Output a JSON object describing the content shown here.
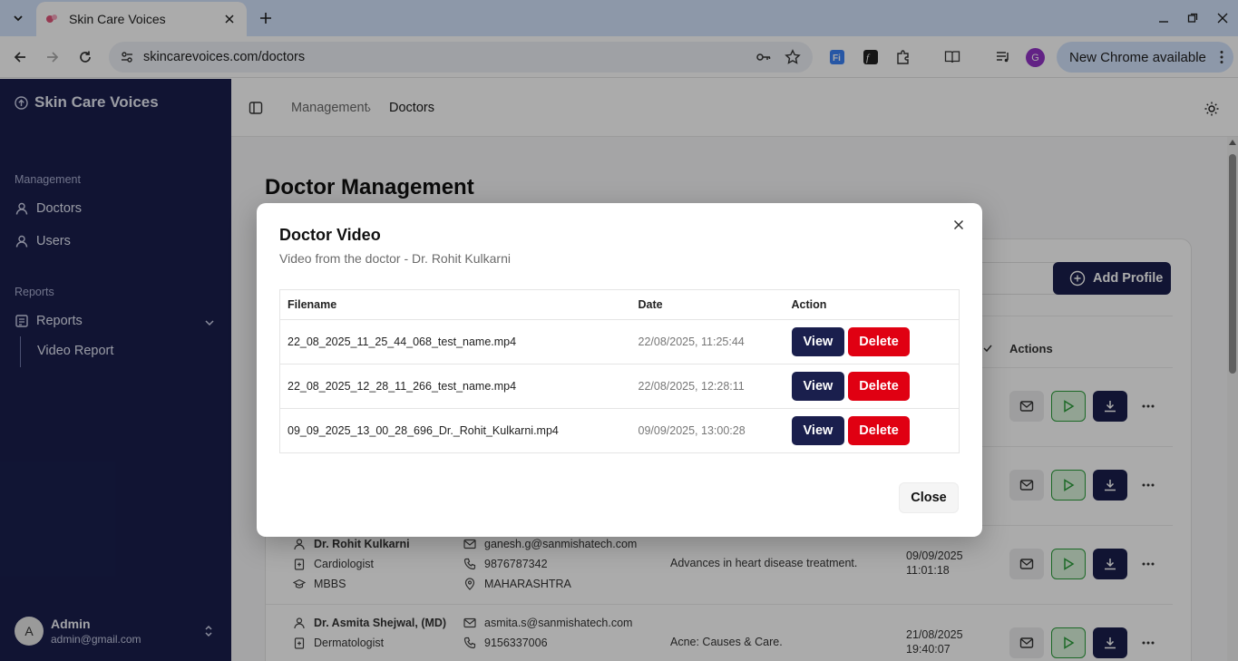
{
  "browser": {
    "tab_title": "Skin Care Voices",
    "url": "skincarevoices.com/doctors",
    "profile_initial": "G",
    "update_label": "New Chrome available"
  },
  "sidebar": {
    "brand": "Skin Care Voices",
    "section_management": "Management",
    "items": [
      {
        "label": "Doctors",
        "icon": "user-icon"
      },
      {
        "label": "Users",
        "icon": "user-icon"
      }
    ],
    "section_reports": "Reports",
    "reports_label": "Reports",
    "sub_items": [
      {
        "label": "Video Report"
      }
    ],
    "user": {
      "initial": "A",
      "name": "Admin",
      "email": "admin@gmail.com"
    }
  },
  "header": {
    "breadcrumb_parent": "Management",
    "breadcrumb_separator": "›",
    "breadcrumb_current": "Doctors"
  },
  "page": {
    "title": "Doctor Management",
    "add_profile_label": "Add Profile",
    "actions_header": "Actions",
    "rows": [
      {
        "name": "Dr. Rohit Kulkarni",
        "specialty": "Cardiologist",
        "degree": "MBBS",
        "email": "ganesh.g@sanmishatech.com",
        "phone": "9876787342",
        "state": "MAHARASHTRA",
        "topic": "Advances in heart disease treatment.",
        "date": "09/09/2025",
        "time": "11:01:18"
      },
      {
        "name": "Dr. Asmita Shejwal, (MD)",
        "specialty": "Dermatologist",
        "email": "asmita.s@sanmishatech.com",
        "phone": "9156337006",
        "topic": "Acne: Causes & Care.",
        "date": "21/08/2025",
        "time": "19:40:07"
      }
    ]
  },
  "dialog": {
    "title": "Doctor Video",
    "subtitle": "Video from the doctor - Dr. Rohit Kulkarni",
    "columns": [
      "Filename",
      "Date",
      "Action"
    ],
    "videos": [
      {
        "filename": "22_08_2025_11_25_44_068_test_name.mp4",
        "date": "22/08/2025, 11:25:44"
      },
      {
        "filename": "22_08_2025_12_28_11_266_test_name.mp4",
        "date": "22/08/2025, 12:28:11"
      },
      {
        "filename": "09_09_2025_13_00_28_696_Dr._Rohit_Kulkarni.mp4",
        "date": "09/09/2025, 13:00:28"
      }
    ],
    "view_label": "View",
    "delete_label": "Delete",
    "close_label": "Close"
  },
  "colors": {
    "sidebar_bg": "#1a1f4d",
    "primary": "#1a1f4d",
    "danger": "#e00012",
    "play_accent": "#2a9d3a"
  }
}
